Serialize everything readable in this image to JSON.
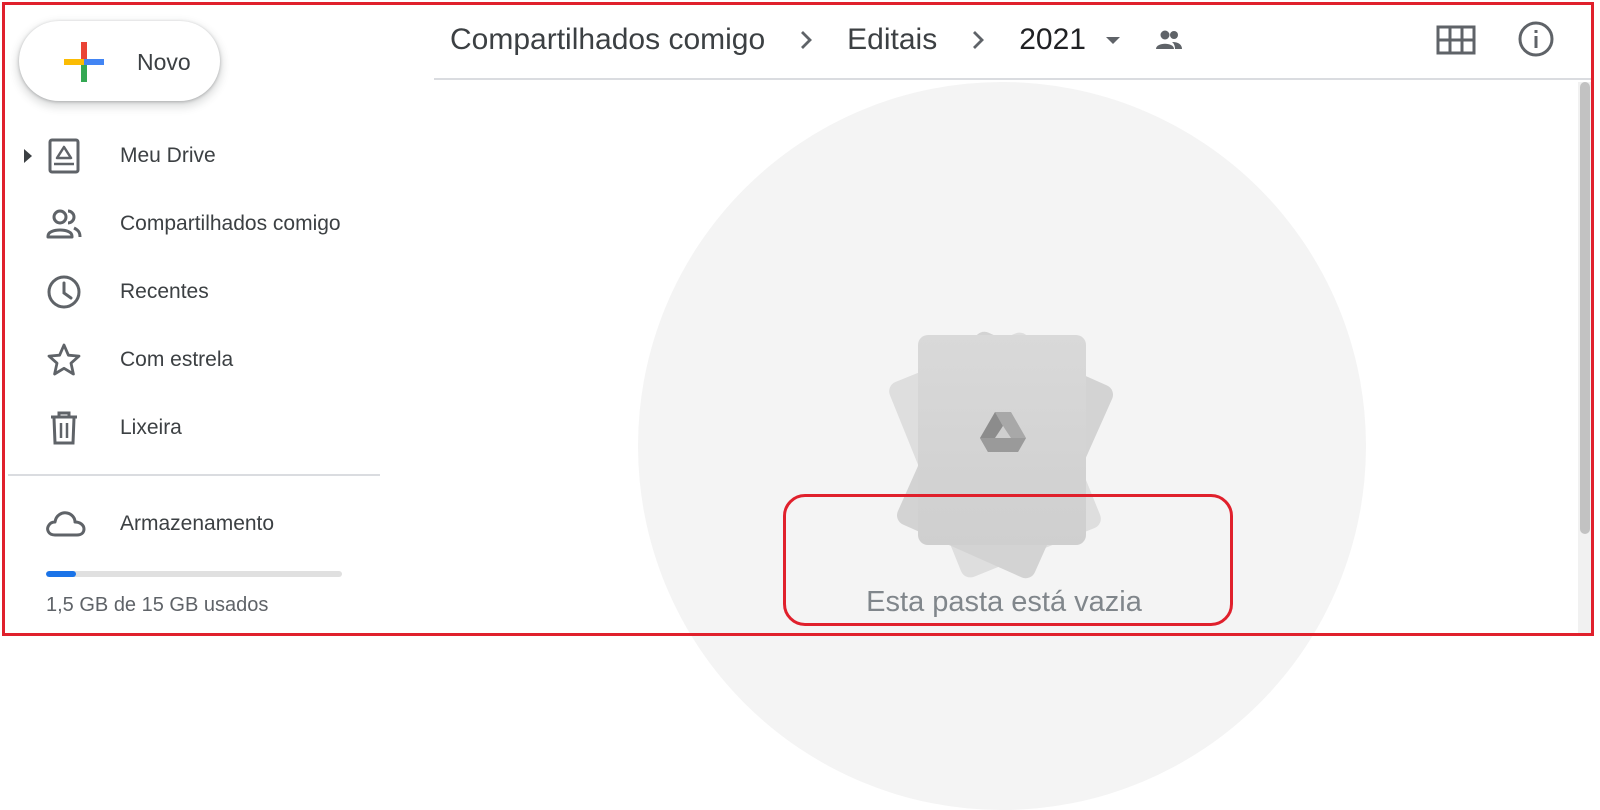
{
  "sidebar": {
    "new_button": {
      "label": "Novo"
    },
    "items": [
      {
        "label": "Meu Drive",
        "icon": "my-drive-icon",
        "expandable": true
      },
      {
        "label": "Compartilhados comigo",
        "icon": "people-icon"
      },
      {
        "label": "Recentes",
        "icon": "clock-icon"
      },
      {
        "label": "Com estrela",
        "icon": "star-icon"
      },
      {
        "label": "Lixeira",
        "icon": "trash-icon"
      }
    ],
    "storage": {
      "label": "Armazenamento",
      "icon": "cloud-icon",
      "usage_text": "1,5 GB de 15 GB usados",
      "used_fraction": 0.1
    }
  },
  "breadcrumb": {
    "items": [
      "Compartilhados comigo",
      "Editais",
      "2021"
    ],
    "shared_indicator_icon": "shared-folder-icon"
  },
  "toolbar": {
    "view_toggle_icon": "grid-view-icon",
    "details_icon": "info-icon"
  },
  "main": {
    "empty_state": {
      "message": "Esta pasta está vazia",
      "illustration_icon": "drive-logo-icon"
    }
  },
  "colors": {
    "accent_blue": "#1a73e8",
    "highlight_red": "#e0202c",
    "text_primary": "#3c4043",
    "text_secondary": "#5f6368"
  }
}
